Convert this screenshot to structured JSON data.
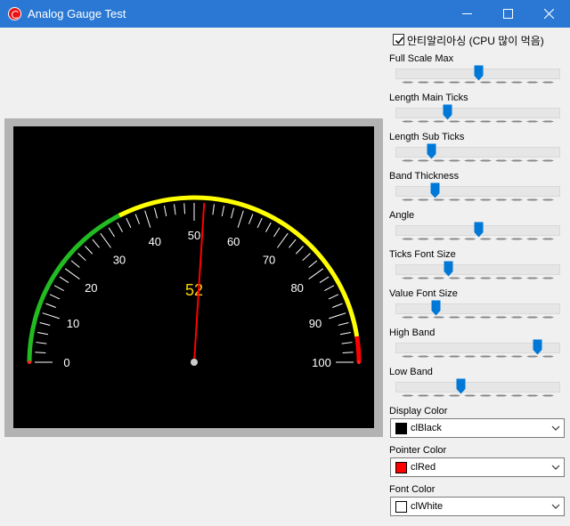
{
  "window": {
    "title": "Analog Gauge Test"
  },
  "gauge": {
    "value": 52,
    "value_text": "52",
    "min": 0,
    "max": 100,
    "major_step": 10,
    "minor_per_major": 5,
    "tick_labels": [
      "0",
      "10",
      "20",
      "30",
      "40",
      "50",
      "60",
      "70",
      "80",
      "90",
      "100"
    ],
    "low_band": 35,
    "high_band": 95,
    "sweep_degrees": 180,
    "display_color": "#000000",
    "pointer_color": "#ff0000",
    "font_color": "#ffffff",
    "value_color": "#ffd400",
    "low_band_color": "#22bb22",
    "mid_band_color": "#ffff00",
    "high_band_color": "#ff0000"
  },
  "controls": {
    "antialias_label": "안티알리아싱 (CPU 많이 먹음)",
    "antialias_checked": true,
    "sliders": [
      {
        "label": "Full Scale Max",
        "value": 0.5
      },
      {
        "label": "Length Main Ticks",
        "value": 0.3
      },
      {
        "label": "Length Sub Ticks",
        "value": 0.2
      },
      {
        "label": "Band Thickness",
        "value": 0.22
      },
      {
        "label": "Angle",
        "value": 0.5
      },
      {
        "label": "Ticks Font Size",
        "value": 0.31
      },
      {
        "label": "Value Font Size",
        "value": 0.23
      },
      {
        "label": "High Band",
        "value": 0.88
      },
      {
        "label": "Low Band",
        "value": 0.39
      }
    ],
    "display_color": {
      "label": "Display Color",
      "value": "clBlack",
      "swatch": "#000000"
    },
    "pointer_color": {
      "label": "Pointer Color",
      "value": "clRed",
      "swatch": "#ff0000"
    },
    "font_color": {
      "label": "Font Color",
      "value": "clWhite",
      "swatch": "#ffffff"
    }
  }
}
